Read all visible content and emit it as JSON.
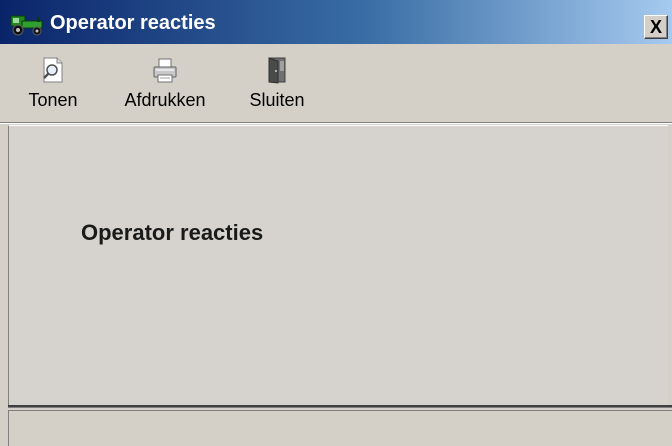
{
  "window": {
    "title": "Operator reacties",
    "app_icon": "tractor-icon",
    "close_label": "X"
  },
  "toolbar": {
    "buttons": [
      {
        "label": "Tonen",
        "icon": "preview-magnifier-icon"
      },
      {
        "label": "Afdrukken",
        "icon": "printer-icon"
      },
      {
        "label": "Sluiten",
        "icon": "exit-door-icon"
      }
    ]
  },
  "report": {
    "title": "Operator reacties"
  },
  "colors": {
    "titlebar_start": "#0a246a",
    "titlebar_end": "#a6caf0",
    "face": "#d4d0c8"
  }
}
